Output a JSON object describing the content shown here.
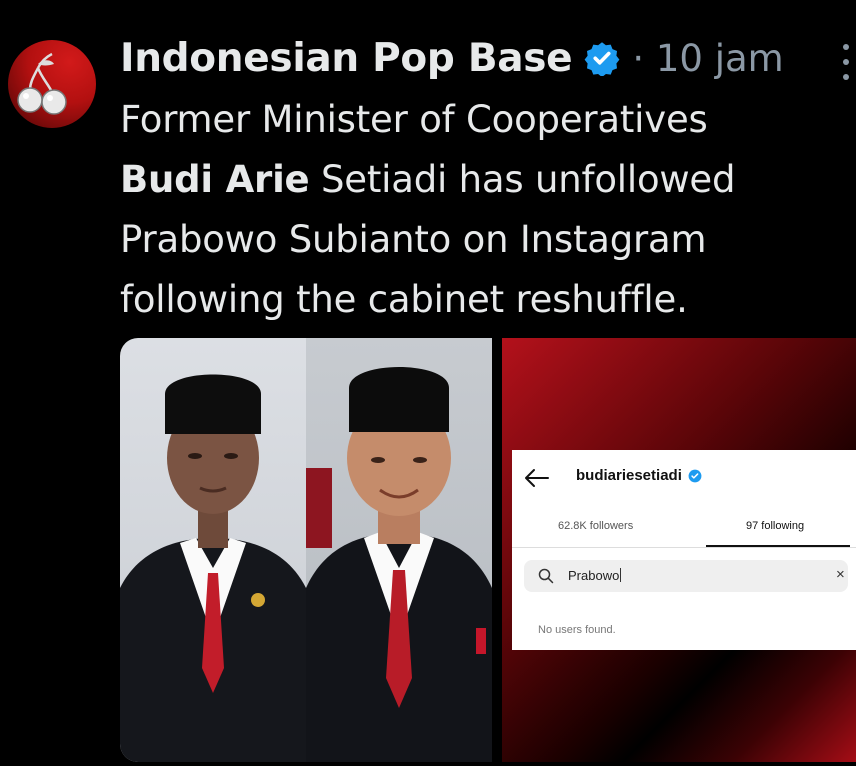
{
  "tweet": {
    "author_name": "Indonesian Pop Base",
    "separator": "·",
    "time": "10 jam",
    "text_lines": [
      "Former Minister of Cooperatives",
      "Setiadi has unfollowed",
      "Prabowo Subianto on Instagram",
      "following the cabinet reshuffle."
    ],
    "bold_name": "Budi Arie",
    "icons": {
      "avatar": "cherry-avatar-icon",
      "verified": "verified-badge-icon",
      "more": "more-options-icon"
    },
    "colors": {
      "background": "#000000",
      "text": "#e7e9ea",
      "muted": "#8b98a5",
      "verified": "#1d9bf0",
      "avatar": "#b31010"
    }
  },
  "instagram_screenshot": {
    "username": "budiariesetiadi",
    "followers": "62.8K followers",
    "following": "97 following",
    "search_value": "Prabowo",
    "empty_message": "No users found.",
    "icons": {
      "back": "back-arrow-icon",
      "verified": "verified-badge-icon",
      "search": "search-icon",
      "clear": "close-icon"
    },
    "clear_glyph": "×"
  }
}
